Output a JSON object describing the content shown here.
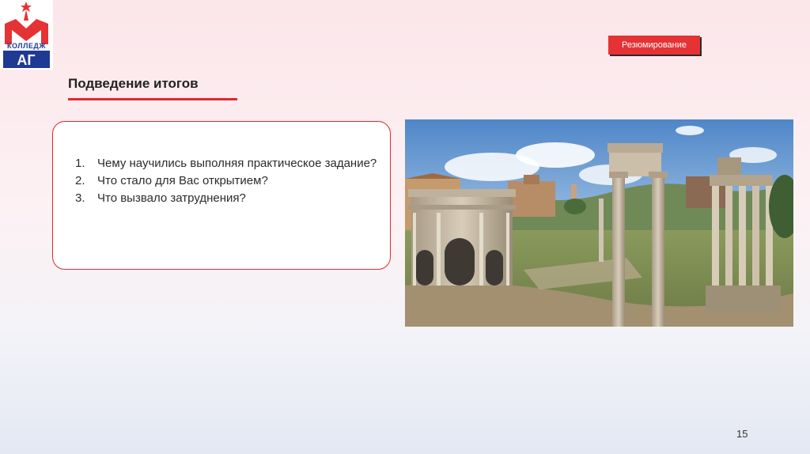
{
  "logo": {
    "text": "КОЛЛЕДЖ",
    "letters": "АГ"
  },
  "badge": {
    "label": "Резюмирование"
  },
  "slide": {
    "title": "Подведение итогов",
    "questions": [
      {
        "num": "1.",
        "text": "Чему научились выполняя практическое задание?"
      },
      {
        "num": "2.",
        "text": "Что стало для Вас открытием?"
      },
      {
        "num": "3.",
        "text": "Что вызвало затруднения?"
      }
    ],
    "page_number": "15"
  },
  "photo": {
    "subject": "roman-forum-ruins"
  },
  "colors": {
    "accent": "#e0272d",
    "badge": "#e53235",
    "logo_blue": "#1f3a93"
  }
}
